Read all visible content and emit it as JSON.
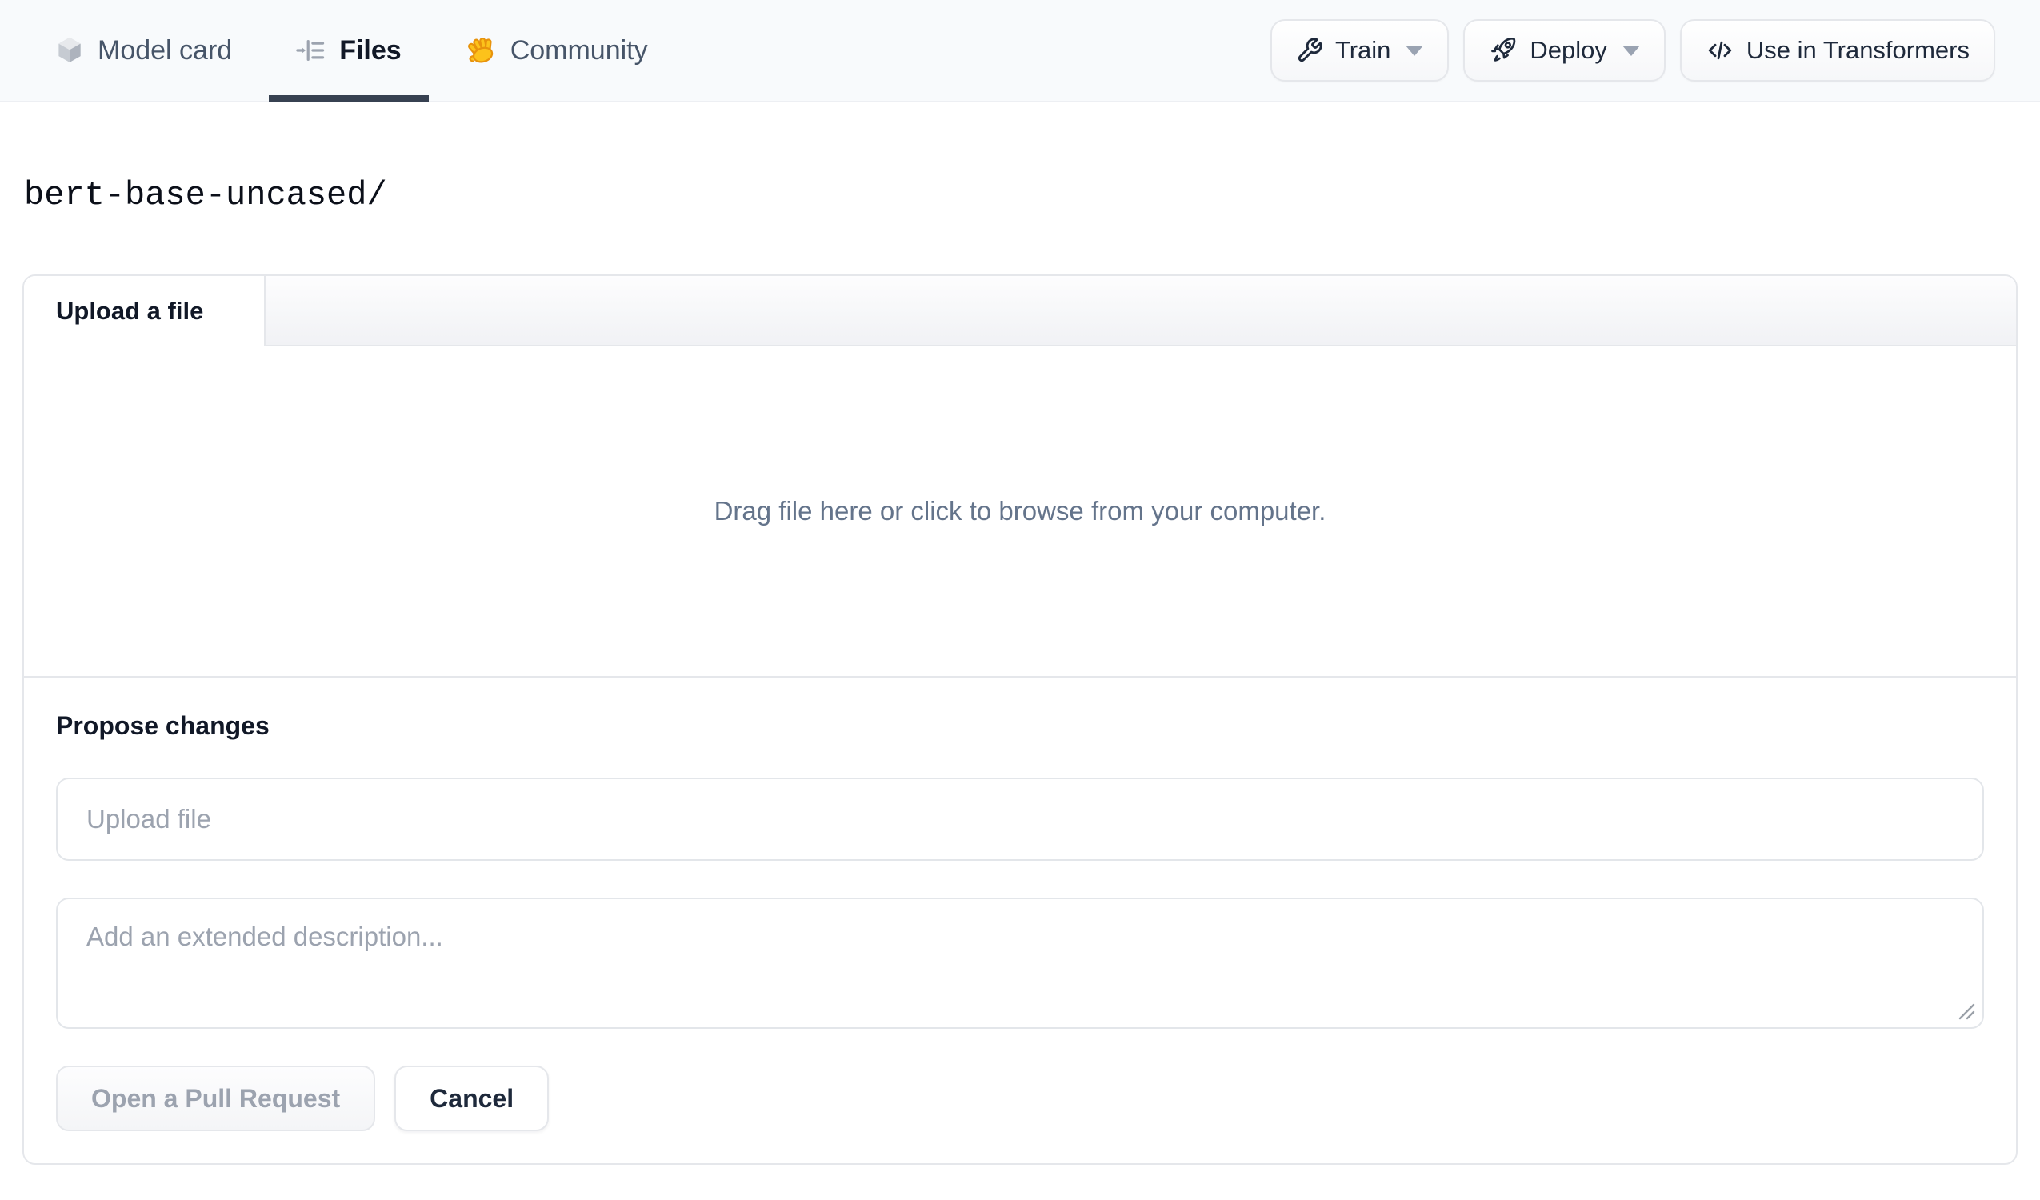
{
  "topbar": {
    "tabs": [
      {
        "label": "Model card",
        "icon": "cube-icon",
        "active": false
      },
      {
        "label": "Files",
        "icon": "files-list-icon",
        "active": true
      },
      {
        "label": "Community",
        "icon": "waving-hand-icon",
        "active": false
      }
    ],
    "actions": [
      {
        "label": "Train",
        "icon": "wrench-icon",
        "has_caret": true
      },
      {
        "label": "Deploy",
        "icon": "rocket-icon",
        "has_caret": true
      },
      {
        "label": "Use in Transformers",
        "icon": "code-icon",
        "has_caret": false
      }
    ]
  },
  "repo_path": "bert-base-uncased/",
  "upload_card": {
    "tab_label": "Upload a file",
    "dropzone_text": "Drag file here or click to browse from your computer.",
    "propose": {
      "heading": "Propose changes",
      "filename_placeholder": "Upload file",
      "description_placeholder": "Add an extended description...",
      "submit_label": "Open a Pull Request",
      "cancel_label": "Cancel"
    }
  },
  "colors": {
    "topbar_bg": "#f8fafc",
    "active_tab_underline": "#374151",
    "border": "#e5e7eb",
    "muted_text": "#64748b",
    "placeholder_text": "#9ca3af",
    "dark_text": "#1e293b",
    "hand_yellow": "#fcc21b"
  }
}
